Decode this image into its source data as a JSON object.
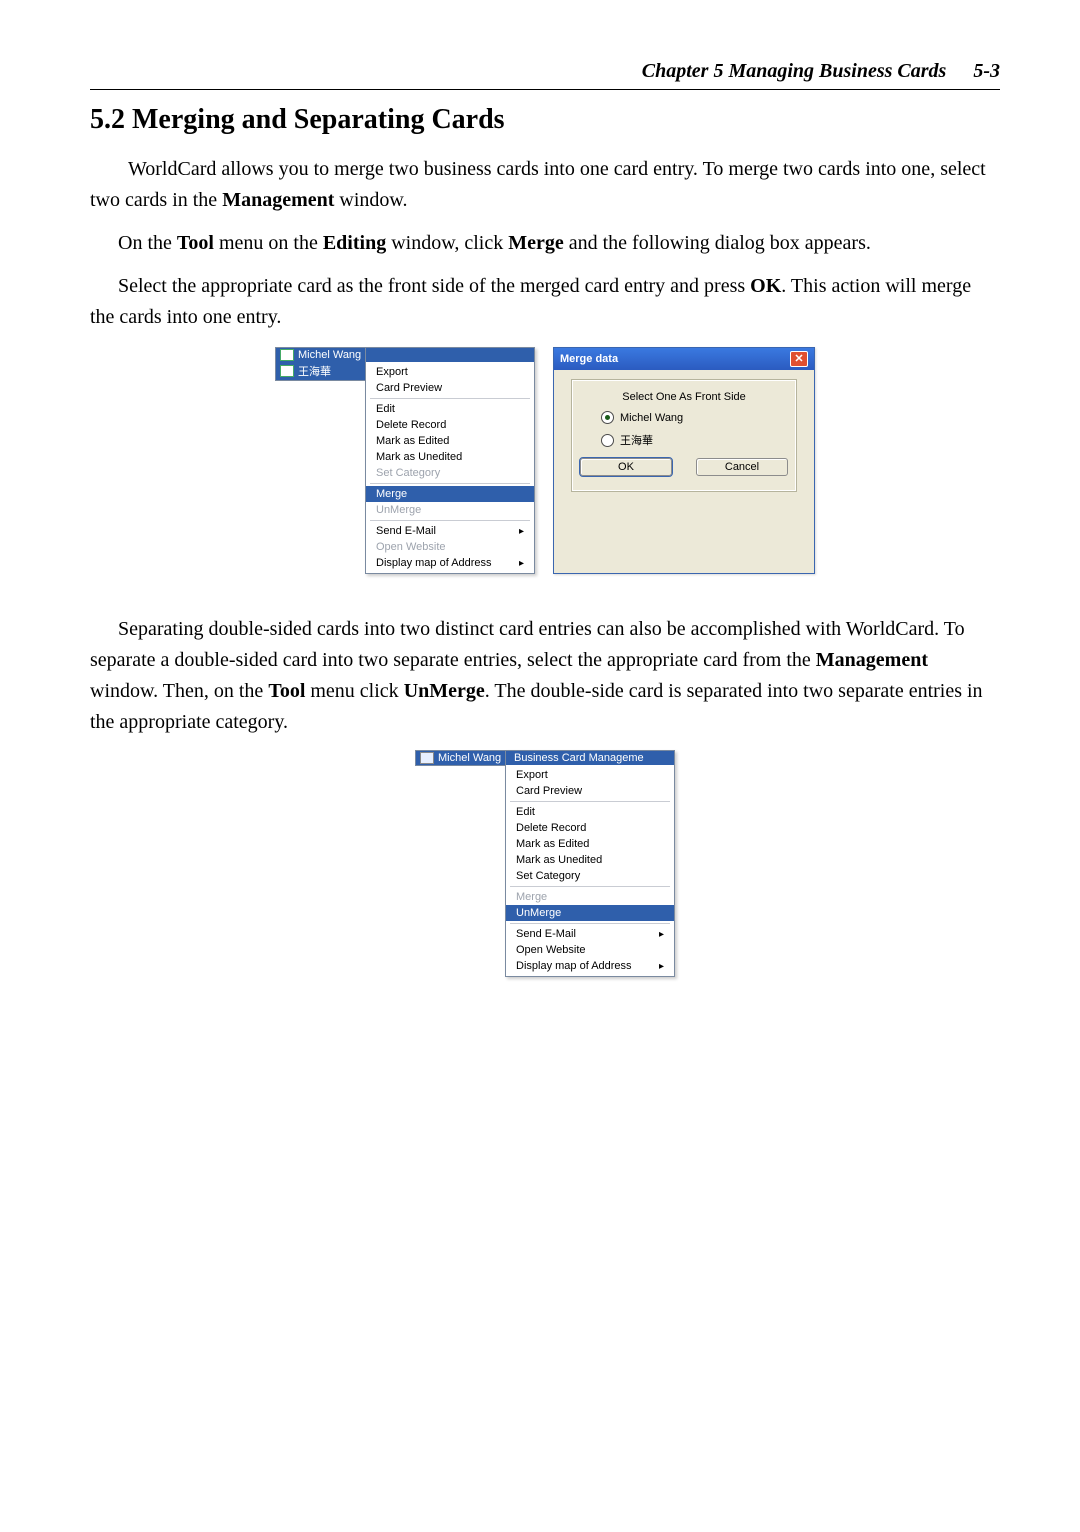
{
  "header": {
    "chapter": "Chapter 5 Managing Business Cards",
    "page": "5-3"
  },
  "section": {
    "title": "5.2 Merging and Separating Cards"
  },
  "para1a": " WorldCard allows you to merge two business cards into one card entry. To merge two cards into one, select two cards in the ",
  "para1b": "Management",
  "para1c": " window.",
  "para2a": "On the ",
  "para2b": "Tool",
  "para2c": " menu on the ",
  "para2d": "Editing",
  "para2e": " window,  click ",
  "para2f": "Merge",
  "para2g": " and the following dialog box appears.",
  "para3a": "Select the appropriate card as the front side of the merged card entry and press ",
  "para3b": "OK",
  "para3c": ". This action will merge the cards into one entry.",
  "para4a": "Separating double-sided cards into two distinct card entries can also be accomplished with WorldCard. To separate a double-sided card into two separate entries, select the appropriate card from the ",
  "para4b": "Management",
  "para4c": " window. Then, on the ",
  "para4d": "Tool",
  "para4e": " menu click ",
  "para4f": "UnMerge",
  "para4g": ". The double-side card is separated into two separate entries in the appropriate category.",
  "list1": {
    "item1": "Michel Wang",
    "item2": "王海華"
  },
  "menu": {
    "topstub": "Business Card Manageme",
    "export": "Export",
    "preview": "Card Preview",
    "edit": "Edit",
    "delete": "Delete Record",
    "markEdited": "Mark as Edited",
    "markUnedited": "Mark as Unedited",
    "setCategory": "Set Category",
    "merge": "Merge",
    "unmerge": "UnMerge",
    "sendEmail": "Send E-Mail",
    "openWebsite": "Open Website",
    "displayMap": "Display map of Address"
  },
  "dialog": {
    "title": "Merge data",
    "label": "Select One As Front Side",
    "opt1": "Michel Wang",
    "opt2": "王海華",
    "ok": "OK",
    "cancel": "Cancel"
  },
  "list2": {
    "item1": "Michel Wang"
  }
}
